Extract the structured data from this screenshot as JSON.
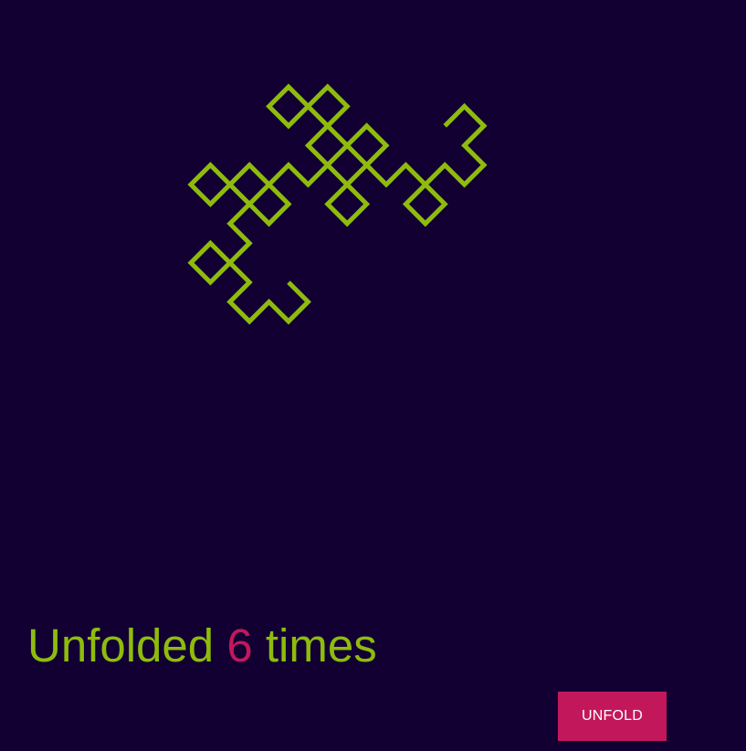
{
  "colors": {
    "background": "#120033",
    "curve": "#8fbc0c",
    "accent": "#c2185b",
    "button_text": "#ffffff"
  },
  "curve": {
    "folds": 6
  },
  "status": {
    "prefix": "Unfolded",
    "count": "6",
    "suffix": "times"
  },
  "controls": {
    "unfold_label": "UNFOLD"
  }
}
